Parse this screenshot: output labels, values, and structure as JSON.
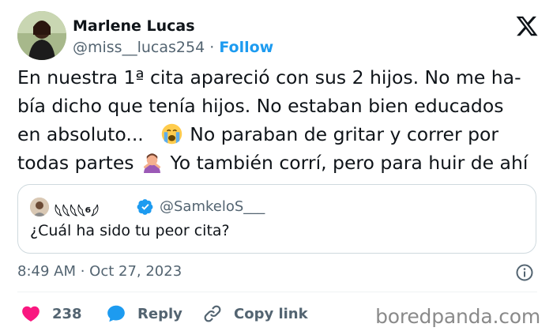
{
  "author": {
    "name": "Marlene Lucas",
    "handle": "@miss__lucas254",
    "separator": "·",
    "follow_label": "Follow"
  },
  "tweet": {
    "lines": [
      "En nuestra 1ª cita apareció con sus 2 hijos. No me ha-",
      "bía dicho que tenía hijos. No estaban bien educados",
      "en absoluto...",
      "No paraban de gritar y correr por",
      "todas partes",
      "Yo también corrí, pero para huir de ahí"
    ]
  },
  "quoted_tweet": {
    "name": "𓆩𓆩𓆩𓆩⁶𓆪",
    "handle": "@SamkeloS___",
    "text": "¿Cuál ha sido tu peor cita?"
  },
  "timestamp": "8:49 AM · Oct 27, 2023",
  "actions": {
    "like_count": "238",
    "reply_label": "Reply",
    "copy_label": "Copy link"
  },
  "watermark": "boredpanda.com",
  "colors": {
    "accent": "#1d9bf0",
    "like": "#f91880",
    "secondary_text": "#536471"
  },
  "icons": [
    "x-logo-icon",
    "crying-face-emoji",
    "person-gesturing-no-emoji",
    "verified-badge-icon",
    "info-icon",
    "heart-icon",
    "reply-bubble-icon",
    "link-icon"
  ]
}
